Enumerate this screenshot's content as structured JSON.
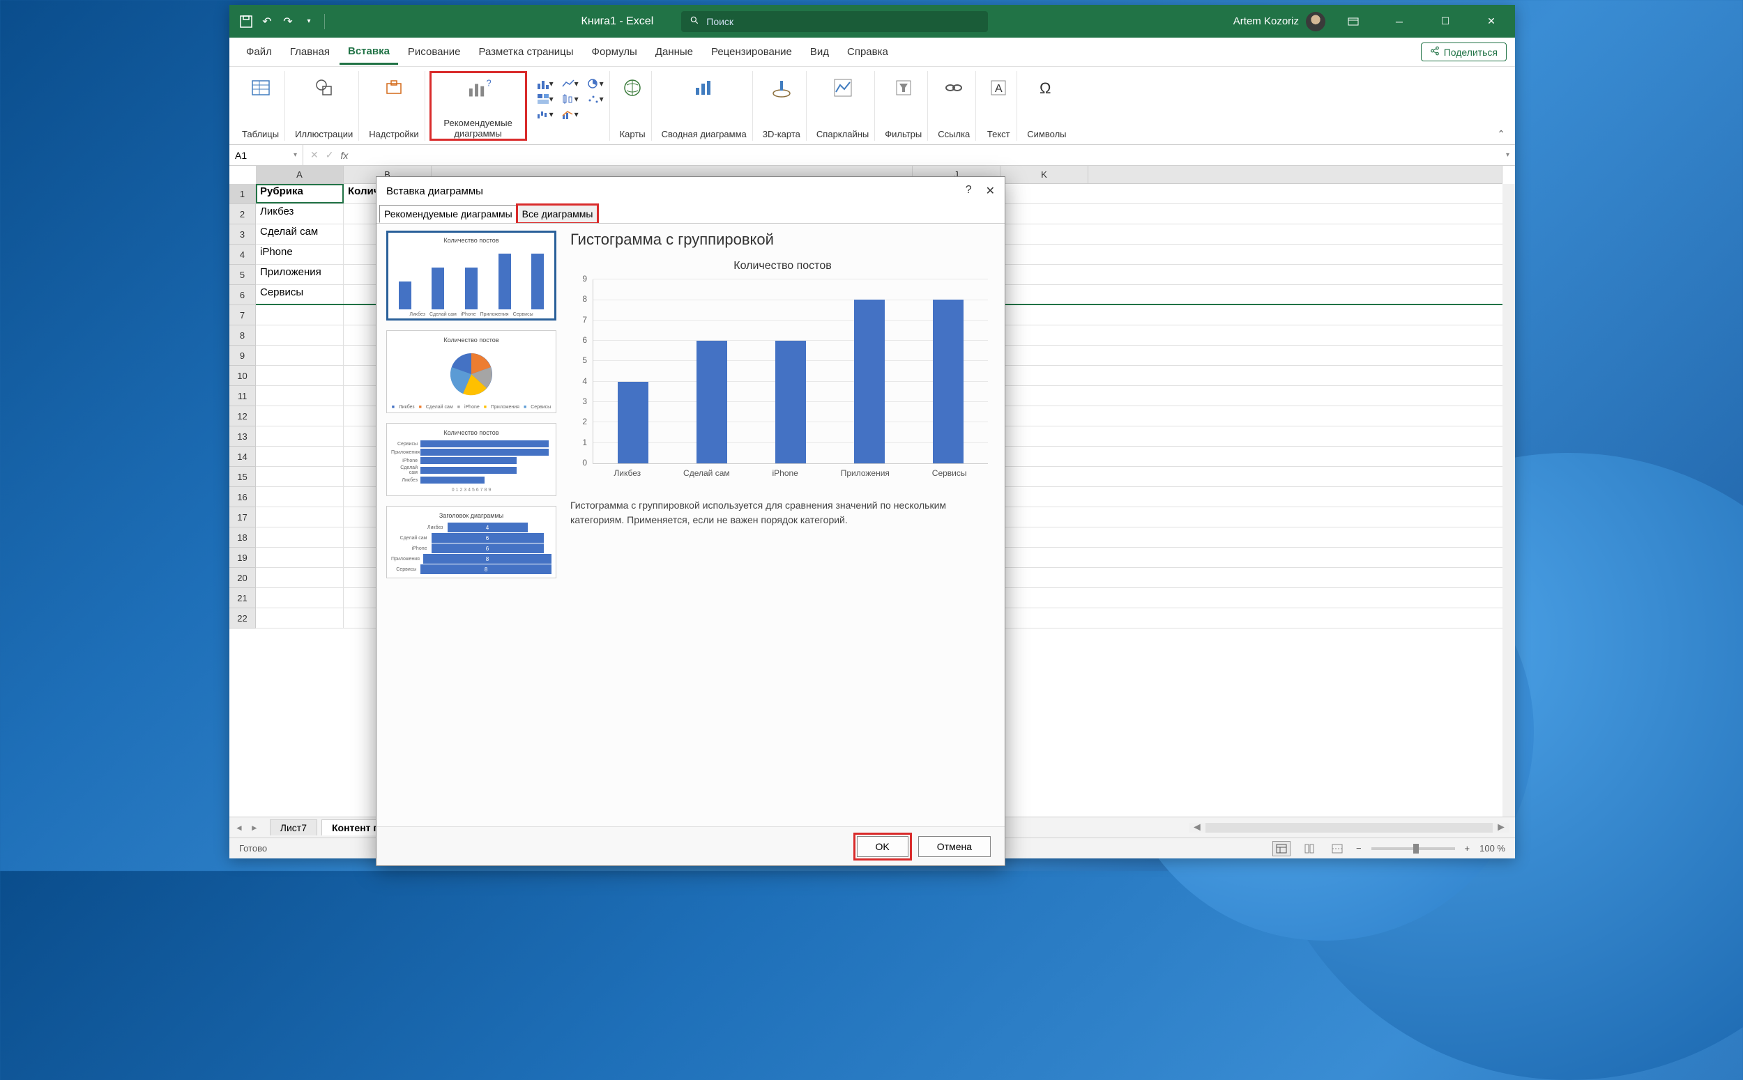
{
  "titlebar": {
    "title": "Книга1  -  Excel",
    "search_placeholder": "Поиск",
    "user": "Artem Kozoriz"
  },
  "tabs": {
    "file": "Файл",
    "home": "Главная",
    "insert": "Вставка",
    "draw": "Рисование",
    "pagelayout": "Разметка страницы",
    "formulas": "Формулы",
    "data": "Данные",
    "review": "Рецензирование",
    "view": "Вид",
    "help": "Справка",
    "share": "Поделиться"
  },
  "ribbon": {
    "tables": "Таблицы",
    "illustrations": "Иллюстрации",
    "addins": "Надстройки",
    "recommended": "Рекомендуемые диаграммы",
    "maps": "Карты",
    "pivotchart": "Сводная диаграмма",
    "map3d": "3D-карта",
    "sparklines": "Спарклайны",
    "filters": "Фильтры",
    "link": "Ссылка",
    "text": "Текст",
    "symbols": "Символы"
  },
  "formula_bar": {
    "namebox": "A1"
  },
  "columns": [
    "A",
    "B",
    "J",
    "K"
  ],
  "rows": [
    "1",
    "2",
    "3",
    "4",
    "5",
    "6",
    "7",
    "8",
    "9",
    "10",
    "11",
    "12",
    "13",
    "14",
    "15",
    "16",
    "17",
    "18",
    "19",
    "20",
    "21",
    "22"
  ],
  "cells": {
    "header_a": "Рубрика",
    "header_b": "Количество постов",
    "r2": "Ликбез",
    "r3": "Сделай сам",
    "r4": "iPhone",
    "r5": "Приложения",
    "r6": "Сервисы"
  },
  "sheet_tabs": {
    "s1": "Лист7",
    "s2": "Контент п"
  },
  "statusbar": {
    "ready": "Готово",
    "zoom": "100 %"
  },
  "dialog": {
    "title": "Вставка диаграммы",
    "tab1": "Рекомендуемые диаграммы",
    "tab2": "Все диаграммы",
    "preview_heading": "Гистограмма с группировкой",
    "chart_title": "Количество постов",
    "thumb_title": "Количество постов",
    "thumb4_title": "Заголовок диаграммы",
    "legend": [
      "Ликбез",
      "Сделай сам",
      "iPhone",
      "Приложения",
      "Сервисы"
    ],
    "description": "Гистограмма с группировкой используется для сравнения значений по нескольким категориям. Применяется, если не важен порядок категорий.",
    "ok": "OK",
    "cancel": "Отмена"
  },
  "chart_data": {
    "type": "bar",
    "title": "Количество постов",
    "categories": [
      "Ликбез",
      "Сделай сам",
      "iPhone",
      "Приложения",
      "Сервисы"
    ],
    "values": [
      4,
      6,
      6,
      8,
      8
    ],
    "xlabel": "",
    "ylabel": "",
    "ylim": [
      0,
      9
    ],
    "yticks": [
      0,
      1,
      2,
      3,
      4,
      5,
      6,
      7,
      8,
      9
    ]
  }
}
